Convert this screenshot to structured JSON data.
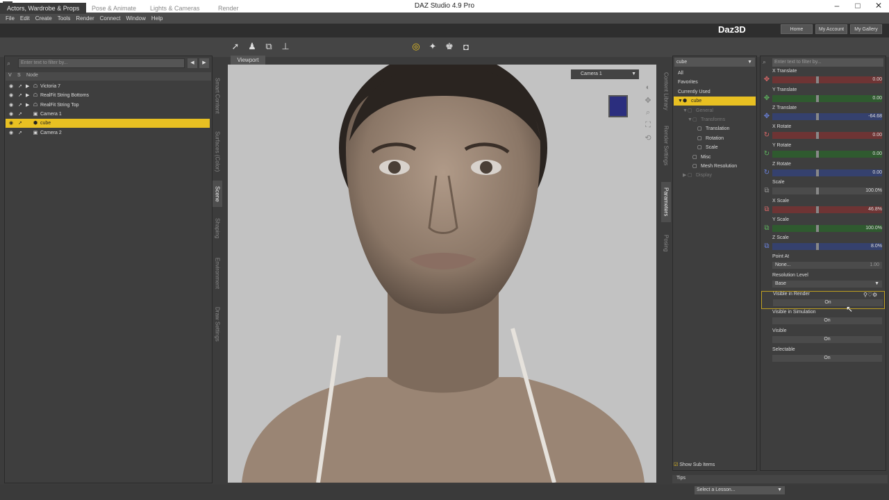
{
  "window": {
    "title": "DAZ Studio 4.9 Pro",
    "app_icon": "DS"
  },
  "menu": [
    "File",
    "Edit",
    "Create",
    "Tools",
    "Render",
    "Connect",
    "Window",
    "Help"
  ],
  "rooms": [
    "Actors, Wardrobe & Props",
    "Pose & Animate",
    "Lights & Cameras",
    "Render"
  ],
  "brand": "Daz3D",
  "top_links": [
    "Home",
    "My Account",
    "My Gallery"
  ],
  "scene": {
    "filter_placeholder": "Enter text to filter by...",
    "col_v": "V",
    "col_s": "S",
    "col_node": "Node",
    "rows": [
      {
        "label": "Victoria 7",
        "icon": "figure-icon",
        "expand": "▶",
        "selected": false
      },
      {
        "label": "RealFit String Bottoms",
        "icon": "figure-icon",
        "expand": "▶",
        "selected": false
      },
      {
        "label": "RealFit String Top",
        "icon": "figure-icon",
        "expand": "▶",
        "selected": false
      },
      {
        "label": "Camera 1",
        "icon": "camera-icon",
        "expand": "",
        "selected": false
      },
      {
        "label": "cube",
        "icon": "cube-icon",
        "expand": "",
        "selected": true
      },
      {
        "label": "Camera 2",
        "icon": "camera-icon",
        "expand": "",
        "selected": false
      }
    ]
  },
  "left_vtabs": [
    "Smart Content",
    "Surfaces (Color)",
    "Scene",
    "Shaping",
    "Environment",
    "Draw Settings"
  ],
  "viewport": {
    "tab": "Viewport",
    "camera": "Camera 1"
  },
  "right_vtabs": [
    "Content Library",
    "Render Settings",
    "Parameters",
    "Posing"
  ],
  "property_node": {
    "selected_node": "cube",
    "rows": [
      {
        "label": "All",
        "indent": 0,
        "style": ""
      },
      {
        "label": "Favorites",
        "indent": 0,
        "style": ""
      },
      {
        "label": "Currently Used",
        "indent": 0,
        "style": ""
      },
      {
        "label": "cube",
        "indent": 0,
        "style": "sel",
        "expand": "▼"
      },
      {
        "label": "General",
        "indent": 1,
        "style": "dim",
        "expand": "▼"
      },
      {
        "label": "Transforms",
        "indent": 2,
        "style": "dim",
        "expand": "▼"
      },
      {
        "label": "Translation",
        "indent": 3,
        "style": ""
      },
      {
        "label": "Rotation",
        "indent": 3,
        "style": ""
      },
      {
        "label": "Scale",
        "indent": 3,
        "style": ""
      },
      {
        "label": "Misc",
        "indent": 2,
        "style": ""
      },
      {
        "label": "Mesh Resolution",
        "indent": 2,
        "style": ""
      },
      {
        "label": "Display",
        "indent": 1,
        "style": "dim",
        "expand": "▶"
      }
    ],
    "show_sub_items": "Show Sub Items"
  },
  "parameters": {
    "filter_placeholder": "Enter text to filter by...",
    "items": [
      {
        "label": "X Translate",
        "value": "0.00",
        "type": "slider",
        "color": "#6e3434",
        "icon": "✥",
        "knob": 0.4
      },
      {
        "label": "Y Translate",
        "value": "0.00",
        "type": "slider",
        "color": "#2f5a2f",
        "icon": "✥",
        "knob": 0.4
      },
      {
        "label": "Z Translate",
        "value": "-64.68",
        "type": "slider",
        "color": "#35416e",
        "icon": "✥",
        "knob": 0.4
      },
      {
        "label": "X Rotate",
        "value": "0.00",
        "type": "slider",
        "color": "#6e3434",
        "icon": "↻",
        "knob": 0.4
      },
      {
        "label": "Y Rotate",
        "value": "0.00",
        "type": "slider",
        "color": "#2f5a2f",
        "icon": "↻",
        "knob": 0.4
      },
      {
        "label": "Z Rotate",
        "value": "0.00",
        "type": "slider",
        "color": "#35416e",
        "icon": "↻",
        "knob": 0.4
      },
      {
        "label": "Scale",
        "value": "100.0%",
        "type": "slider",
        "color": "#4b4b4b",
        "icon": "⧉",
        "knob": 0.4
      },
      {
        "label": "X Scale",
        "value": "46.8%",
        "type": "slider",
        "color": "#6e3434",
        "icon": "⧉",
        "knob": 0.4
      },
      {
        "label": "Y Scale",
        "value": "100.0%",
        "type": "slider",
        "color": "#2f5a2f",
        "icon": "⧉",
        "knob": 0.4
      },
      {
        "label": "Z Scale",
        "value": "8.0%",
        "type": "slider",
        "color": "#35416e",
        "icon": "⧉",
        "knob": 0.4
      },
      {
        "label": "Point At",
        "value": "None...",
        "type": "text",
        "extra": "1.00"
      },
      {
        "label": "Resolution Level",
        "value": "Base",
        "type": "select"
      },
      {
        "label": "Visible in Render",
        "value": "On",
        "type": "toggle",
        "highlight": true
      },
      {
        "label": "Visible in Simulation",
        "value": "On",
        "type": "toggle"
      },
      {
        "label": "Visible",
        "value": "On",
        "type": "toggle"
      },
      {
        "label": "Selectable",
        "value": "On",
        "type": "toggle"
      }
    ]
  },
  "tips_tab": "Tips",
  "lesson_select": "Select a Lesson..."
}
